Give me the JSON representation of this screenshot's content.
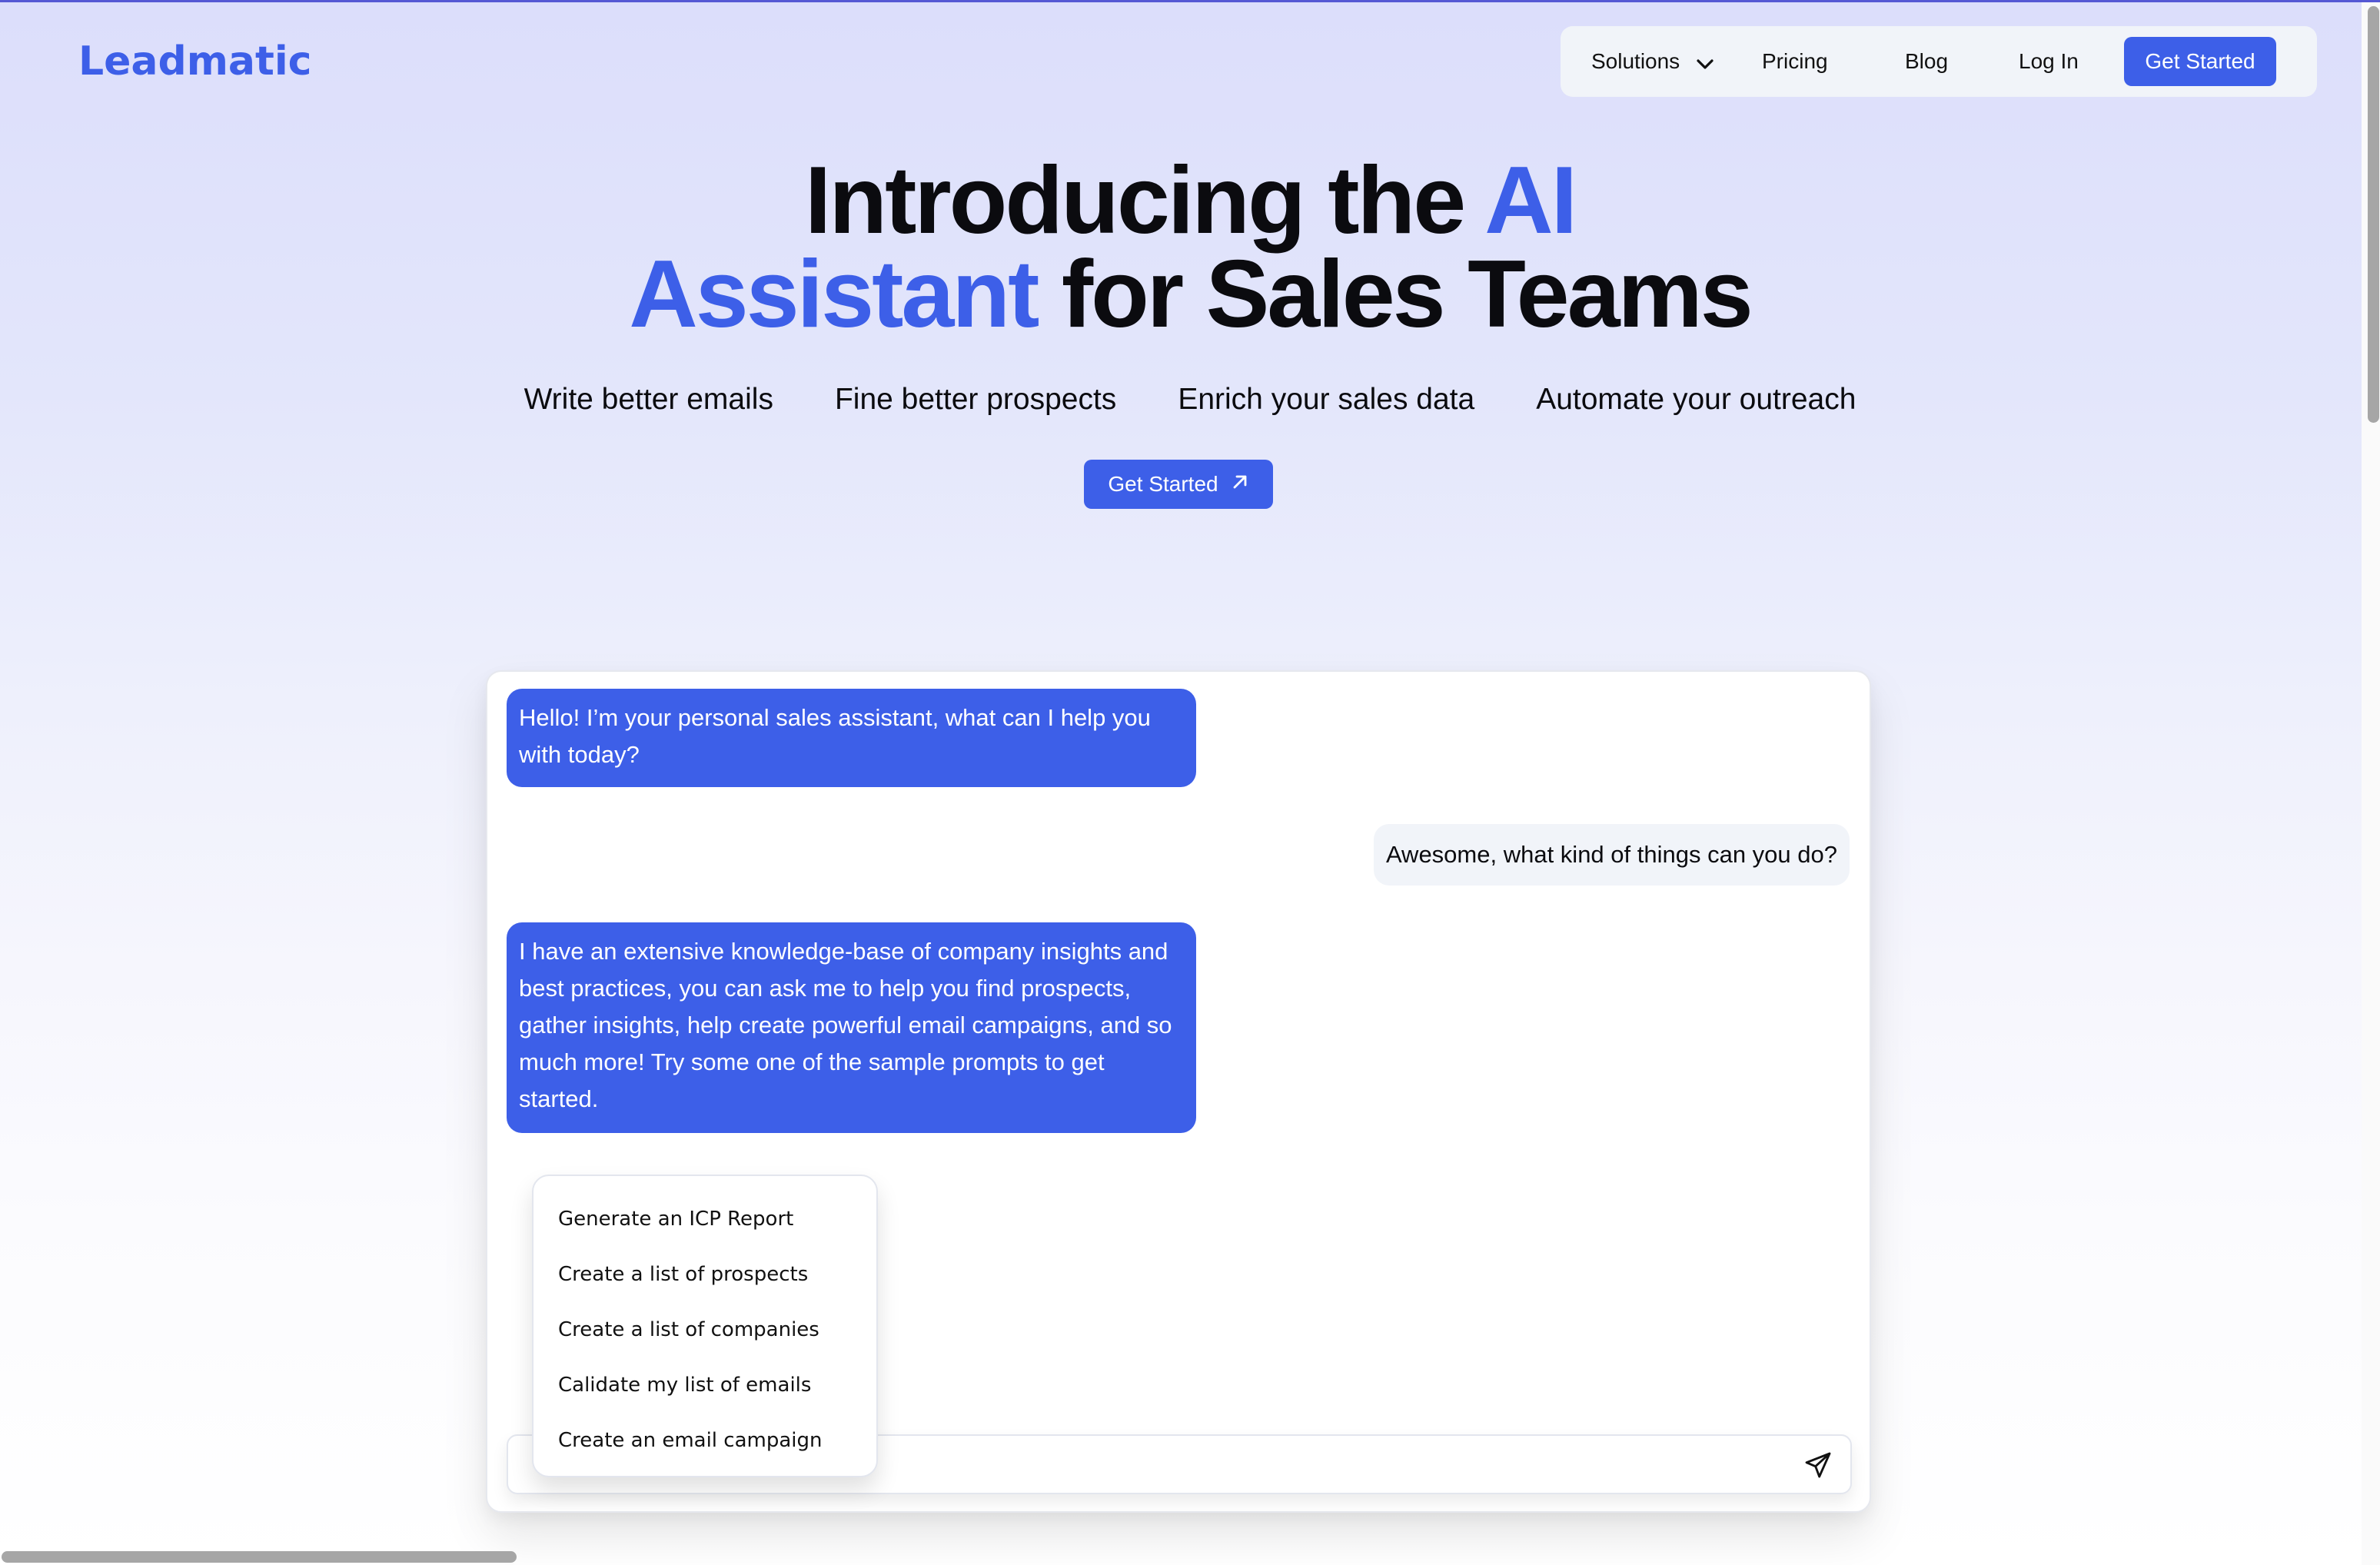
{
  "brand": {
    "name": "Leadmatic",
    "accent_color": "#3d5fe8"
  },
  "nav": {
    "items": [
      {
        "label": "Solutions",
        "has_dropdown": true
      },
      {
        "label": "Pricing"
      },
      {
        "label": "Blog"
      },
      {
        "label": "Log In"
      }
    ],
    "cta_label": "Get Started"
  },
  "hero": {
    "title_part1": "Introducing the ",
    "title_accent1": "AI",
    "title_accent2": "Assistant",
    "title_part2": " for Sales Teams",
    "features": [
      "Write better emails",
      "Fine better prospects",
      "Enrich your sales data",
      "Automate your outreach"
    ],
    "cta_label": "Get Started",
    "cta_icon": "arrow-up-right-icon"
  },
  "chat": {
    "messages": [
      {
        "role": "assistant",
        "text": "Hello! I’m your personal sales assistant, what can I help you with today?"
      },
      {
        "role": "user",
        "text": "Awesome, what kind of things can you do?"
      },
      {
        "role": "assistant",
        "text": "I have an extensive knowledge-base of company insights and best practices, you can ask me to help you find prospects, gather insights, help create powerful email campaigns, and so much more! Try some one of the sample prompts to get started."
      }
    ],
    "sample_prompts": [
      "Generate an ICP Report",
      "Create a list of prospects",
      "Create a list of companies",
      "Calidate my list of emails",
      "Create an email campaign"
    ],
    "input": {
      "value": "",
      "placeholder": ""
    },
    "send_icon": "send-icon"
  }
}
